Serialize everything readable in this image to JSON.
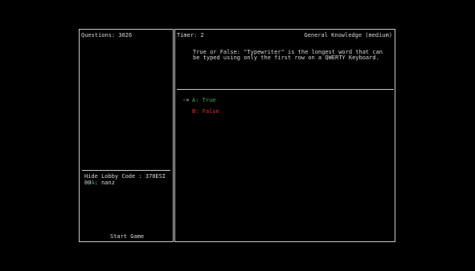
{
  "lobby": {
    "questions_label": "Questions: 3026",
    "lobby_code_text": "Hide Lobby Code : 370ESI",
    "player": {
      "id": "00",
      "status_letter": "A",
      "name_suffix": ": nanz"
    },
    "start_button_label": "Start Game"
  },
  "question_panel": {
    "timer_label": "Timer: 2",
    "category_label": "General Knowledge (medium)",
    "question_lines": [
      "True or False: \"Typewriter\" is the longest word that can",
      "be typed using only the first row on a QWERTY Keyboard."
    ]
  },
  "answers": {
    "cursor": "->",
    "options": [
      {
        "label": "A: True",
        "color": "#3cb043"
      },
      {
        "label": "B: False",
        "color": "#e03030"
      }
    ]
  },
  "colors": {
    "background": "#000000",
    "border": "#c8c8c8",
    "text": "#d8d8d8",
    "correct_green": "#3cb043",
    "wrong_red": "#e03030"
  }
}
